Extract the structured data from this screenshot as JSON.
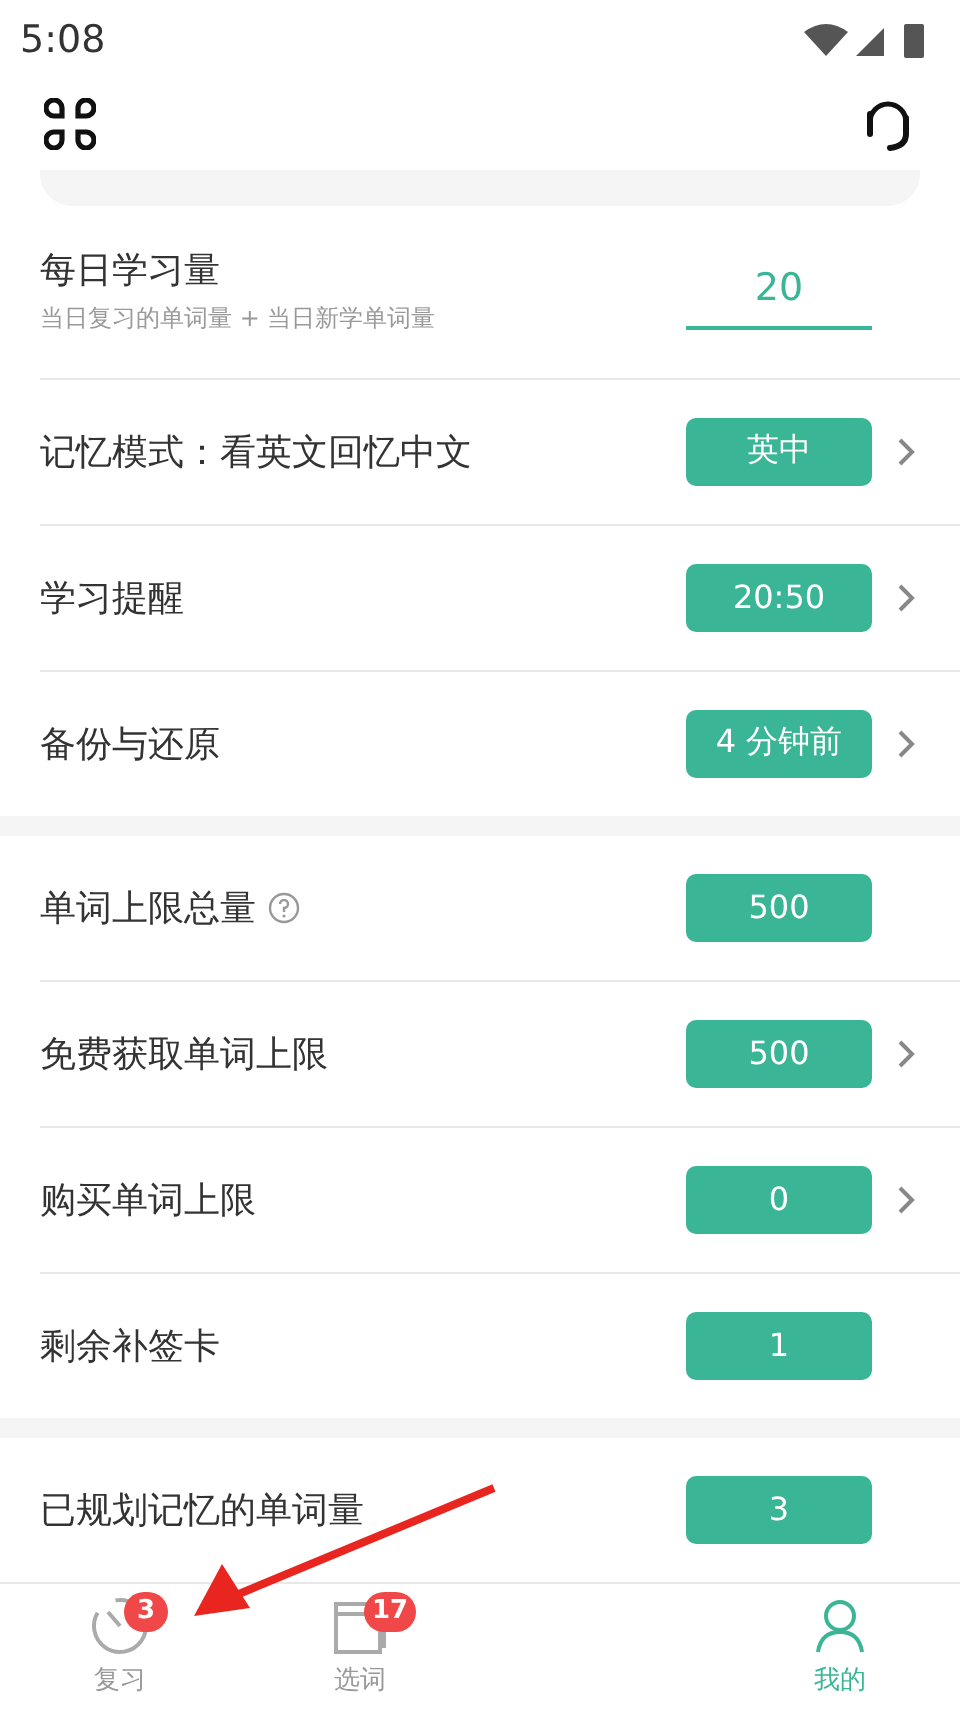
{
  "status_bar": {
    "time": "5:08"
  },
  "daily": {
    "title": "每日学习量",
    "subtitle": "当日复习的单词量 + 当日新学单词量",
    "value": "20"
  },
  "sections": [
    {
      "rows": [
        {
          "label": "记忆模式：看英文回忆中文",
          "value": "英中",
          "help": false,
          "chevron": true
        },
        {
          "label": "学习提醒",
          "value": "20:50",
          "help": false,
          "chevron": true
        },
        {
          "label": "备份与还原",
          "value": "4 分钟前",
          "help": false,
          "chevron": true
        }
      ]
    },
    {
      "rows": [
        {
          "label": "单词上限总量",
          "value": "500",
          "help": true,
          "chevron": false
        },
        {
          "label": "免费获取单词上限",
          "value": "500",
          "help": false,
          "chevron": true
        },
        {
          "label": "购买单词上限",
          "value": "0",
          "help": false,
          "chevron": true
        },
        {
          "label": "剩余补签卡",
          "value": "1",
          "help": false,
          "chevron": false
        }
      ]
    },
    {
      "rows": [
        {
          "label": "已规划记忆的单词量",
          "value": "3",
          "help": false,
          "chevron": false
        }
      ]
    }
  ],
  "tabs": [
    {
      "label": "复习",
      "badge": "3",
      "kind": "gauge",
      "selected": false
    },
    {
      "label": "选词",
      "badge": "17",
      "kind": "window",
      "selected": false
    },
    {
      "label": "我的",
      "kind": "person",
      "selected": true
    }
  ]
}
